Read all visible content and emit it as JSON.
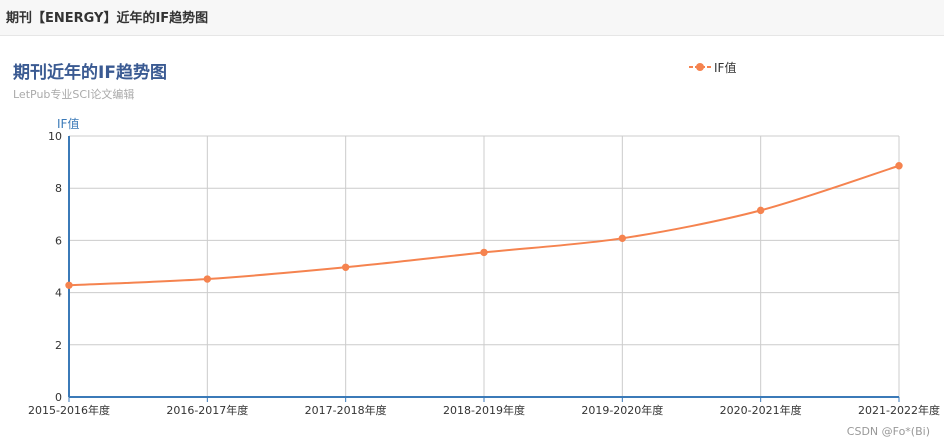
{
  "header": {
    "title": "期刊【ENERGY】近年的IF趋势图"
  },
  "watermark": "CSDN @Fo*(Bi)",
  "colors": {
    "line": "#f5834f",
    "axis": "#3b7ab8",
    "title": "#3a5a92"
  },
  "chart_data": {
    "type": "line",
    "title": "期刊近年的IF趋势图",
    "subtitle": "LetPub专业SCI论文编辑",
    "ylabel": "IF值",
    "xlabel": "",
    "ylim": [
      0,
      10
    ],
    "yticks": [
      0,
      2,
      4,
      6,
      8,
      10
    ],
    "grid": true,
    "legend_position": "top-right",
    "categories": [
      "2015-2016年度",
      "2016-2017年度",
      "2017-2018年度",
      "2018-2019年度",
      "2019-2020年度",
      "2020-2021年度",
      "2021-2022年度"
    ],
    "series": [
      {
        "name": "IF值",
        "values": [
          4.28,
          4.52,
          4.97,
          5.54,
          6.08,
          7.15,
          8.86
        ]
      }
    ]
  }
}
